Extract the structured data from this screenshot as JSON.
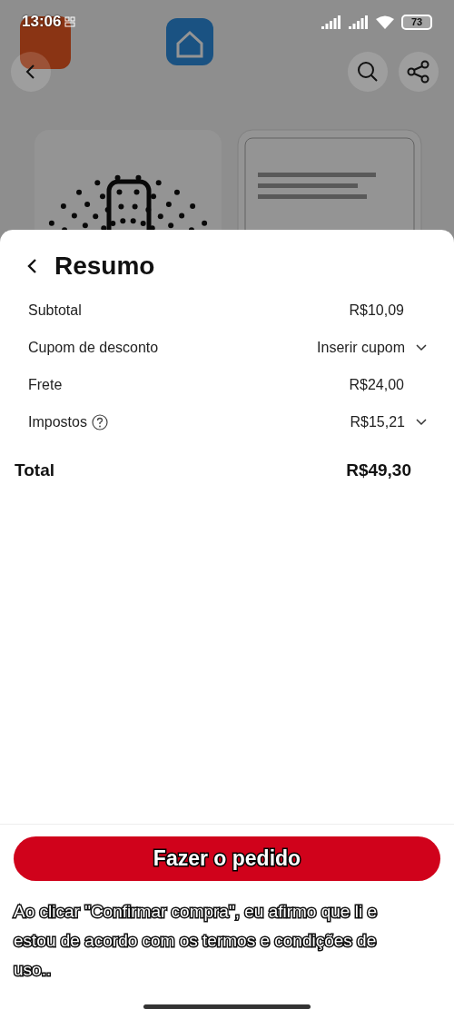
{
  "status_bar": {
    "time": "13:06",
    "battery": "73"
  },
  "summary": {
    "title": "Resumo",
    "rows": [
      {
        "label": "Subtotal",
        "value": "R$10,09",
        "kind": "amount",
        "help": false
      },
      {
        "label": "Cupom de desconto",
        "value": "Inserir cupom",
        "kind": "dropdown",
        "help": false
      },
      {
        "label": "Frete",
        "value": "R$24,00",
        "kind": "amount",
        "help": false
      },
      {
        "label": "Impostos",
        "value": "R$15,21",
        "kind": "dropdown",
        "help": true
      }
    ],
    "total": {
      "label": "Total",
      "value": "R$49,30"
    }
  },
  "footer": {
    "button": "Fazer o pedido",
    "notice": "Ao clicar \"Confirmar compra\", eu afirmo que li e estou de acordo com os termos e condições de uso.."
  }
}
